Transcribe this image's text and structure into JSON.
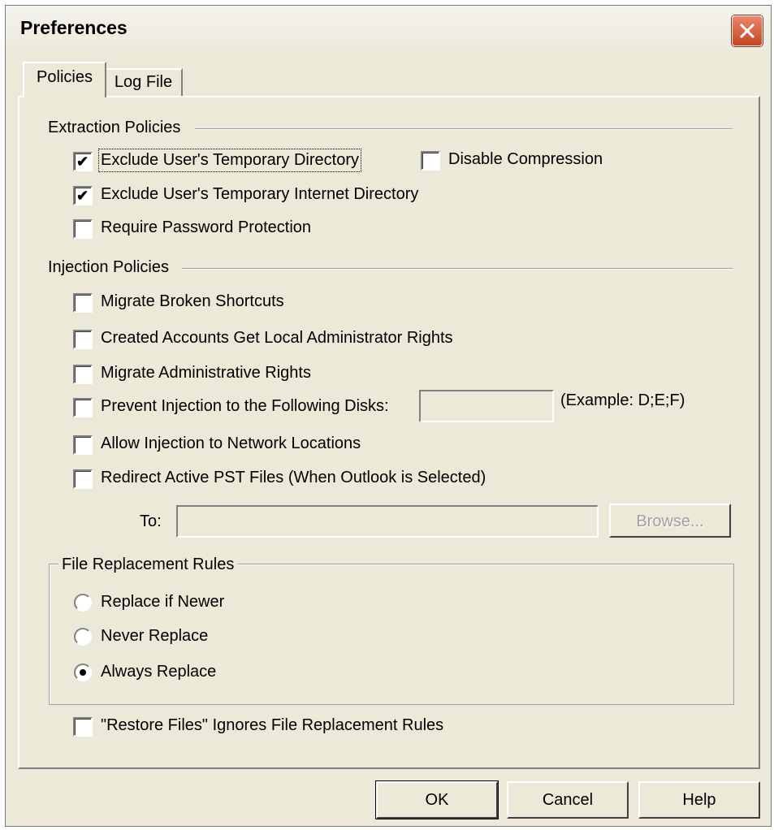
{
  "window": {
    "title": "Preferences"
  },
  "tabs": [
    {
      "label": "Policies",
      "active": true
    },
    {
      "label": "Log File",
      "active": false
    }
  ],
  "extraction": {
    "heading": "Extraction Policies",
    "exclude_temp_dir": {
      "label": "Exclude User's Temporary Directory",
      "checked": true
    },
    "disable_compression": {
      "label": "Disable Compression",
      "checked": false
    },
    "exclude_temp_internet": {
      "label": "Exclude User's Temporary Internet Directory",
      "checked": true
    },
    "require_password": {
      "label": "Require Password Protection",
      "checked": false
    }
  },
  "injection": {
    "heading": "Injection Policies",
    "migrate_shortcuts": {
      "label": "Migrate Broken Shortcuts",
      "checked": false
    },
    "admin_rights_accounts": {
      "label": "Created Accounts Get Local Administrator Rights",
      "checked": false
    },
    "migrate_admin_rights": {
      "label": "Migrate Administrative Rights",
      "checked": false
    },
    "prevent_disks": {
      "label": "Prevent Injection to the Following Disks:",
      "checked": false,
      "value": ""
    },
    "disks_example": "(Example: D;E;F)",
    "allow_network": {
      "label": "Allow Injection to Network Locations",
      "checked": false
    },
    "redirect_pst": {
      "label": "Redirect Active PST Files (When Outlook is Selected)",
      "checked": false
    },
    "to_label": "To:",
    "to_value": "",
    "browse_label": "Browse..."
  },
  "replacement": {
    "heading": "File Replacement Rules",
    "options": [
      {
        "label": "Replace if Newer",
        "selected": false
      },
      {
        "label": "Never Replace",
        "selected": false
      },
      {
        "label": "Always Replace",
        "selected": true
      }
    ]
  },
  "restore_ignores": {
    "label": "\"Restore Files\" Ignores File Replacement Rules",
    "checked": false
  },
  "buttons": {
    "ok": "OK",
    "cancel": "Cancel",
    "help": "Help"
  },
  "colors": {
    "dialog_bg": "#ece9d8",
    "close_red": "#c4451f"
  }
}
